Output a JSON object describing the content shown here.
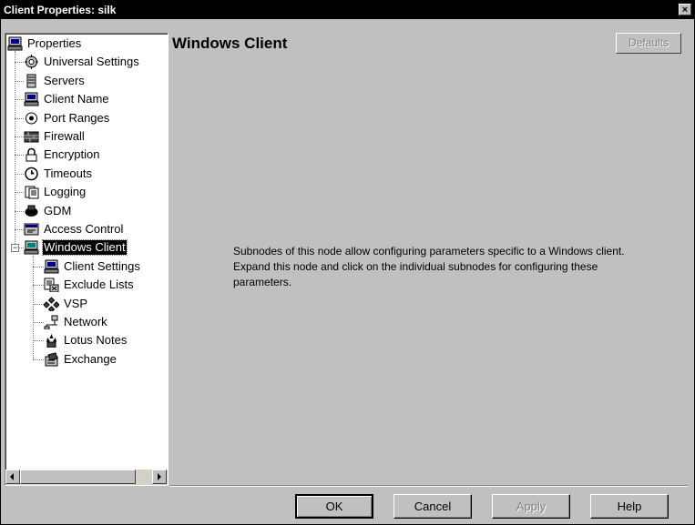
{
  "window": {
    "title": "Client Properties: silk",
    "close_glyph": "×"
  },
  "tree": {
    "root": {
      "label": "Properties",
      "icon": "computer-icon"
    },
    "items": [
      {
        "label": "Universal Settings",
        "icon": "settings-icon"
      },
      {
        "label": "Servers",
        "icon": "server-icon"
      },
      {
        "label": "Client Name",
        "icon": "computer-icon"
      },
      {
        "label": "Port Ranges",
        "icon": "port-icon"
      },
      {
        "label": "Firewall",
        "icon": "firewall-icon"
      },
      {
        "label": "Encryption",
        "icon": "lock-icon"
      },
      {
        "label": "Timeouts",
        "icon": "clock-icon"
      },
      {
        "label": "Logging",
        "icon": "log-icon"
      },
      {
        "label": "GDM",
        "icon": "gdm-icon"
      },
      {
        "label": "Access Control",
        "icon": "access-control-icon"
      },
      {
        "label": "Windows Client",
        "icon": "windows-client-icon",
        "expanded": true,
        "selected": true
      }
    ],
    "subitems": [
      {
        "label": "Client Settings",
        "icon": "computer-icon"
      },
      {
        "label": "Exclude Lists",
        "icon": "exclude-list-icon"
      },
      {
        "label": "VSP",
        "icon": "vsp-icon"
      },
      {
        "label": "Network",
        "icon": "network-icon"
      },
      {
        "label": "Lotus Notes",
        "icon": "lotus-notes-icon"
      },
      {
        "label": "Exchange",
        "icon": "exchange-icon"
      }
    ],
    "expander_glyph": "−"
  },
  "main": {
    "title": "Windows Client",
    "defaults_label": "Defaults",
    "description": "Subnodes of this node allow configuring parameters specific to a Windows client. Expand this node and click on the individual subnodes for configuring these parameters."
  },
  "buttons": {
    "ok": "OK",
    "cancel": "Cancel",
    "apply": "Apply",
    "help": "Help"
  }
}
